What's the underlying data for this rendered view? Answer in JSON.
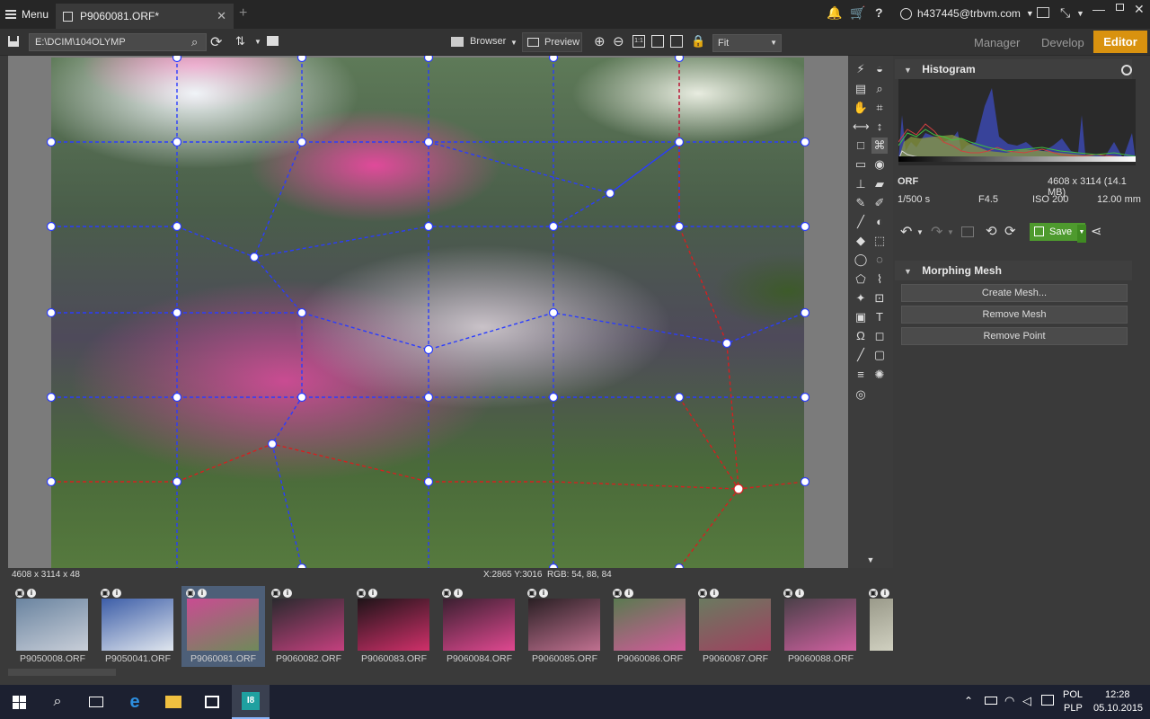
{
  "titlebar": {
    "menu_label": "Menu",
    "doc_tab_label": "P9060081.ORF*",
    "user_label": "h437445@trbvm.com"
  },
  "toolbar": {
    "path_value": "E:\\DCIM\\104OLYMP",
    "browser_label": "Browser",
    "preview_label": "Preview",
    "zoom_select": "Fit",
    "mode_tabs": {
      "manager": "Manager",
      "develop": "Develop",
      "editor": "Editor"
    }
  },
  "canvas": {
    "info_dims": "4608 x 3114 x 48",
    "info_coords": "X:2865 Y:3016",
    "info_rgb": "RGB: 54, 88, 84"
  },
  "histogram": {
    "title": "Histogram",
    "format": "ORF",
    "size": "4608 x 3114 (14.1 MB)",
    "shutter": "1/500 s",
    "aperture": "F4.5",
    "iso": "ISO 200",
    "focal": "12.00 mm"
  },
  "actions": {
    "save_label": "Save"
  },
  "morphing_mesh": {
    "title": "Morphing Mesh",
    "create_label": "Create Mesh...",
    "remove_mesh_label": "Remove Mesh",
    "remove_point_label": "Remove Point"
  },
  "filmstrip": {
    "thumbnails": [
      {
        "label": "P9050008.ORF",
        "colors": [
          "#6a84a0",
          "#c8ced8"
        ]
      },
      {
        "label": "P9050041.ORF",
        "colors": [
          "#3d5ea8",
          "#e0e6ee"
        ]
      },
      {
        "label": "P9060081.ORF",
        "colors": [
          "#c94c92",
          "#6f8a5a"
        ]
      },
      {
        "label": "P9060082.ORF",
        "colors": [
          "#2a2a2e",
          "#c4407e"
        ]
      },
      {
        "label": "P9060083.ORF",
        "colors": [
          "#1e1418",
          "#d0306a"
        ]
      },
      {
        "label": "P9060084.ORF",
        "colors": [
          "#3a2030",
          "#e04890"
        ]
      },
      {
        "label": "P9060085.ORF",
        "colors": [
          "#2a2024",
          "#c07090"
        ]
      },
      {
        "label": "P9060086.ORF",
        "colors": [
          "#5a7a50",
          "#d25a9a"
        ]
      },
      {
        "label": "P9060087.ORF",
        "colors": [
          "#6a7a60",
          "#a04060"
        ]
      },
      {
        "label": "P9060088.ORF",
        "colors": [
          "#4a4048",
          "#d060a0"
        ]
      },
      {
        "label": "P912",
        "colors": [
          "#9a9a8a",
          "#e0e0d0"
        ]
      }
    ]
  },
  "taskbar": {
    "lang": "POL",
    "lang2": "PLP",
    "time": "12:28",
    "date": "05.10.2015"
  }
}
